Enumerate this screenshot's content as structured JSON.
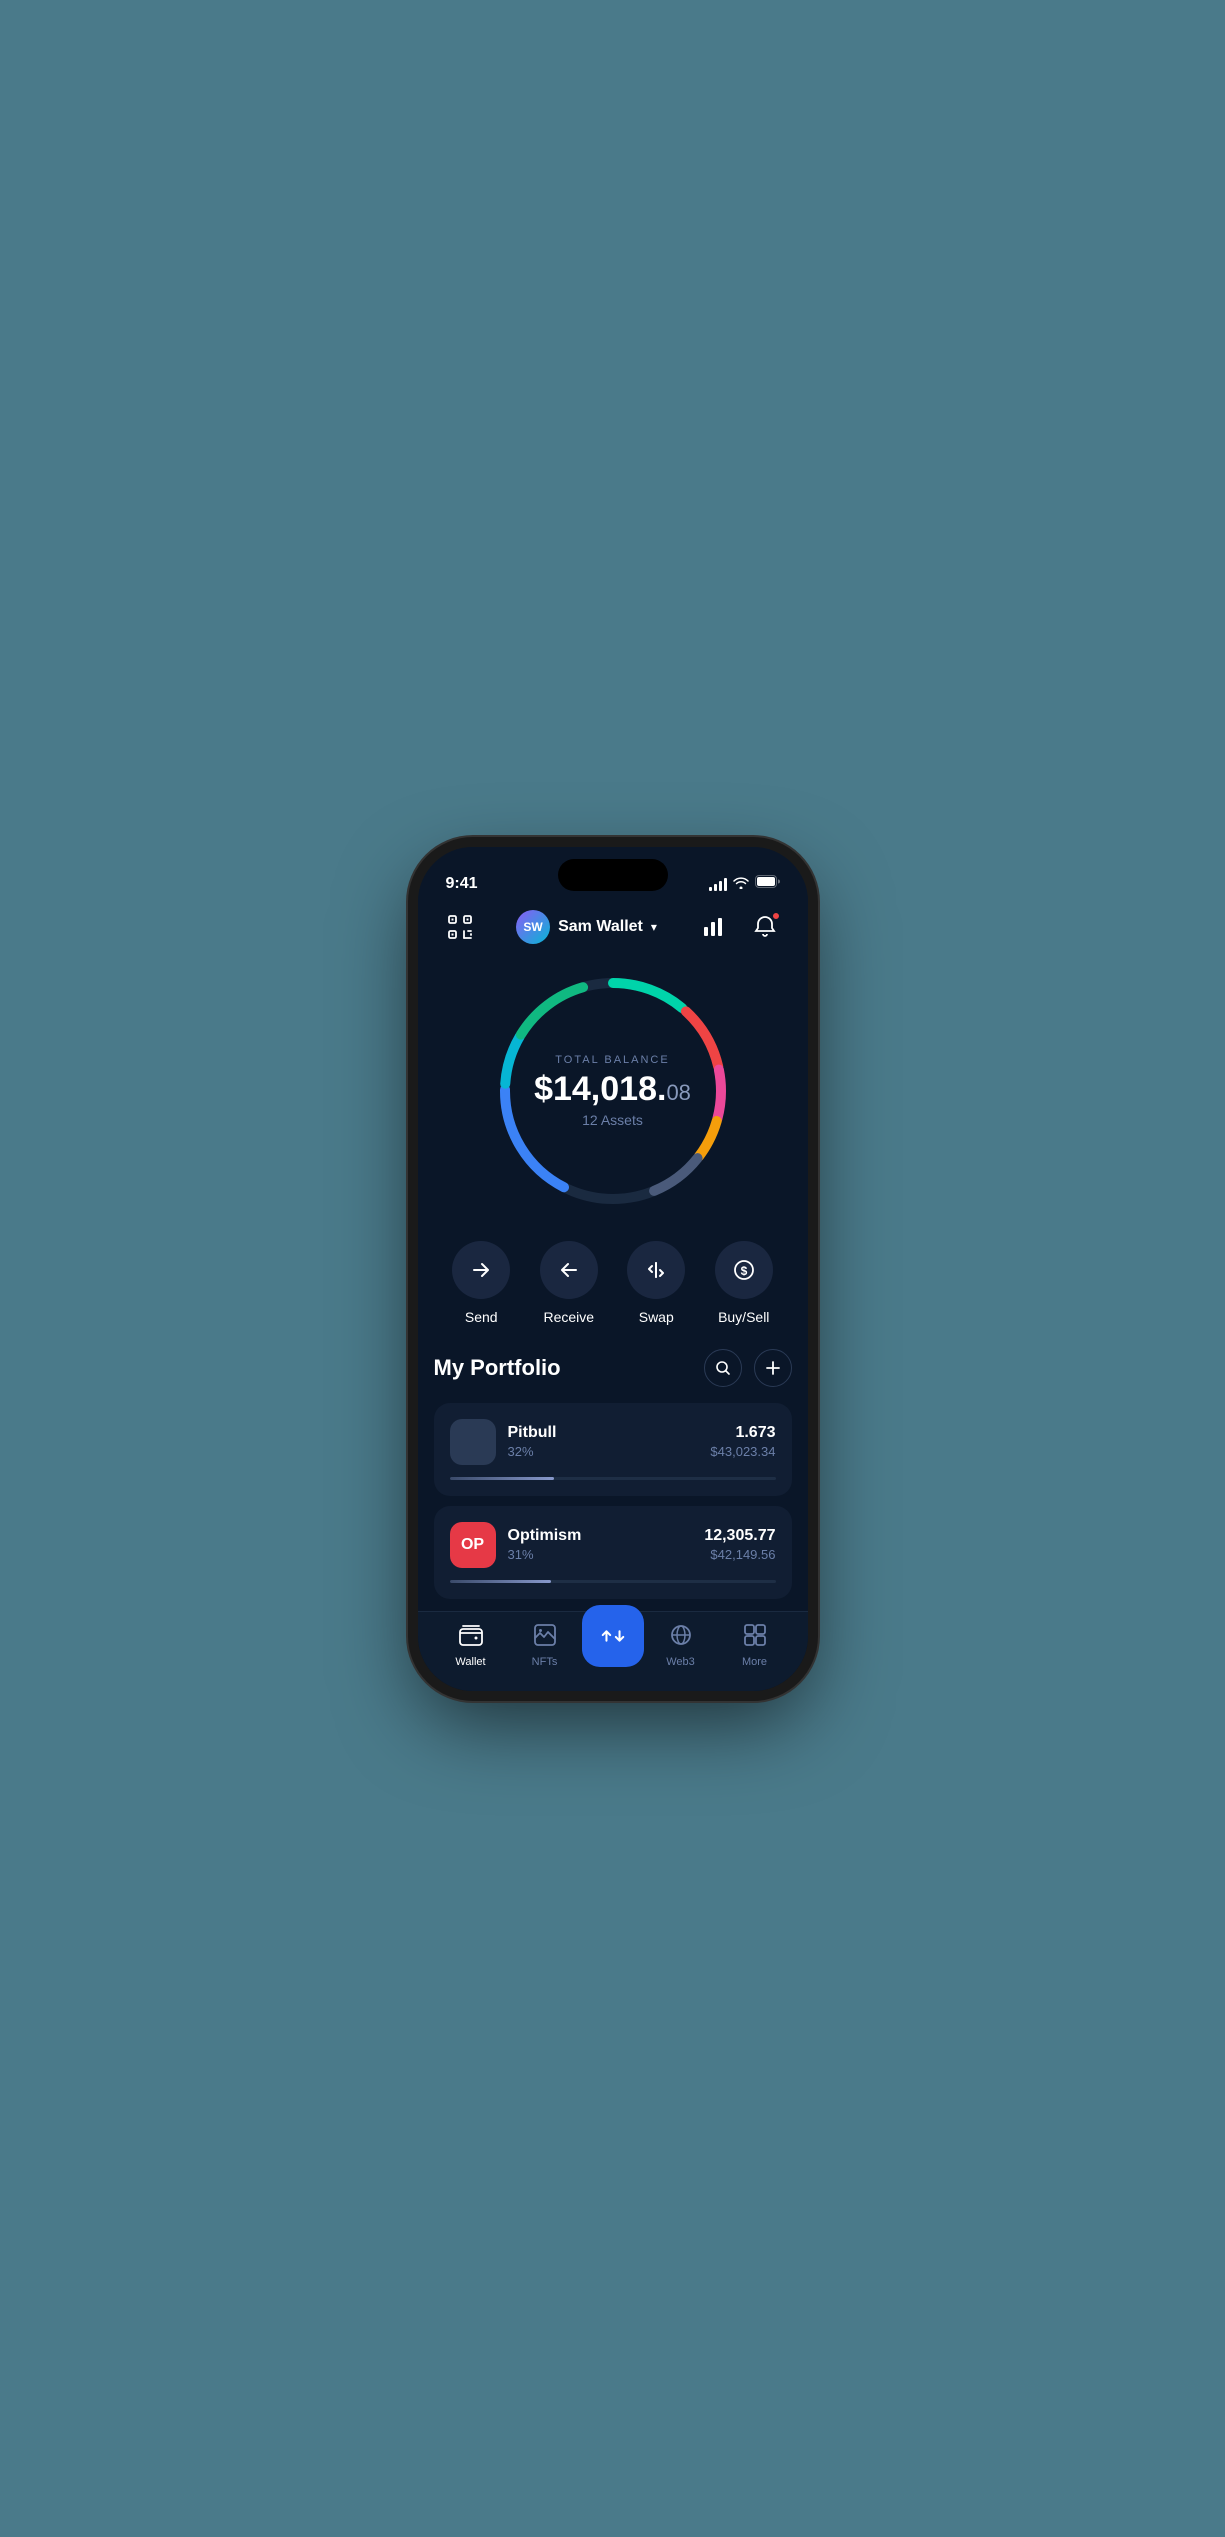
{
  "statusBar": {
    "time": "9:41",
    "signalBars": [
      4,
      7,
      10,
      13,
      14
    ],
    "wifi": "wifi",
    "battery": "battery"
  },
  "header": {
    "scanLabel": "scan",
    "walletName": "Sam Wallet",
    "walletInitials": "SW",
    "chartLabel": "chart",
    "notificationLabel": "notification"
  },
  "balance": {
    "label": "TOTAL BALANCE",
    "mainAmount": "$14,018.",
    "centsAmount": "08",
    "assetsCount": "12 Assets"
  },
  "actions": [
    {
      "id": "send",
      "label": "Send",
      "icon": "→"
    },
    {
      "id": "receive",
      "label": "Receive",
      "icon": "←"
    },
    {
      "id": "swap",
      "label": "Swap",
      "icon": "⇅"
    },
    {
      "id": "buysell",
      "label": "Buy/Sell",
      "icon": "$"
    }
  ],
  "portfolio": {
    "title": "My Portfolio",
    "searchLabel": "search",
    "addLabel": "add",
    "assets": [
      {
        "name": "Pitbull",
        "percent": "32%",
        "amount": "1.673",
        "value": "$43,023.34",
        "progress": 32,
        "iconType": "pitbull"
      },
      {
        "name": "Optimism",
        "percent": "31%",
        "amount": "12,305.77",
        "value": "$42,149.56",
        "progress": 31,
        "iconType": "optimism"
      }
    ]
  },
  "bottomNav": [
    {
      "id": "wallet",
      "label": "Wallet",
      "icon": "wallet",
      "active": true
    },
    {
      "id": "nfts",
      "label": "NFTs",
      "icon": "nfts",
      "active": false
    },
    {
      "id": "center",
      "label": "",
      "icon": "swap-center",
      "active": false,
      "isCenter": true
    },
    {
      "id": "web3",
      "label": "Web3",
      "icon": "web3",
      "active": false
    },
    {
      "id": "more",
      "label": "More",
      "icon": "more",
      "active": false
    }
  ],
  "colors": {
    "background": "#0a1628",
    "card": "#111e33",
    "accent": "#2563eb",
    "text": "#ffffff",
    "muted": "#6b7fa8"
  }
}
